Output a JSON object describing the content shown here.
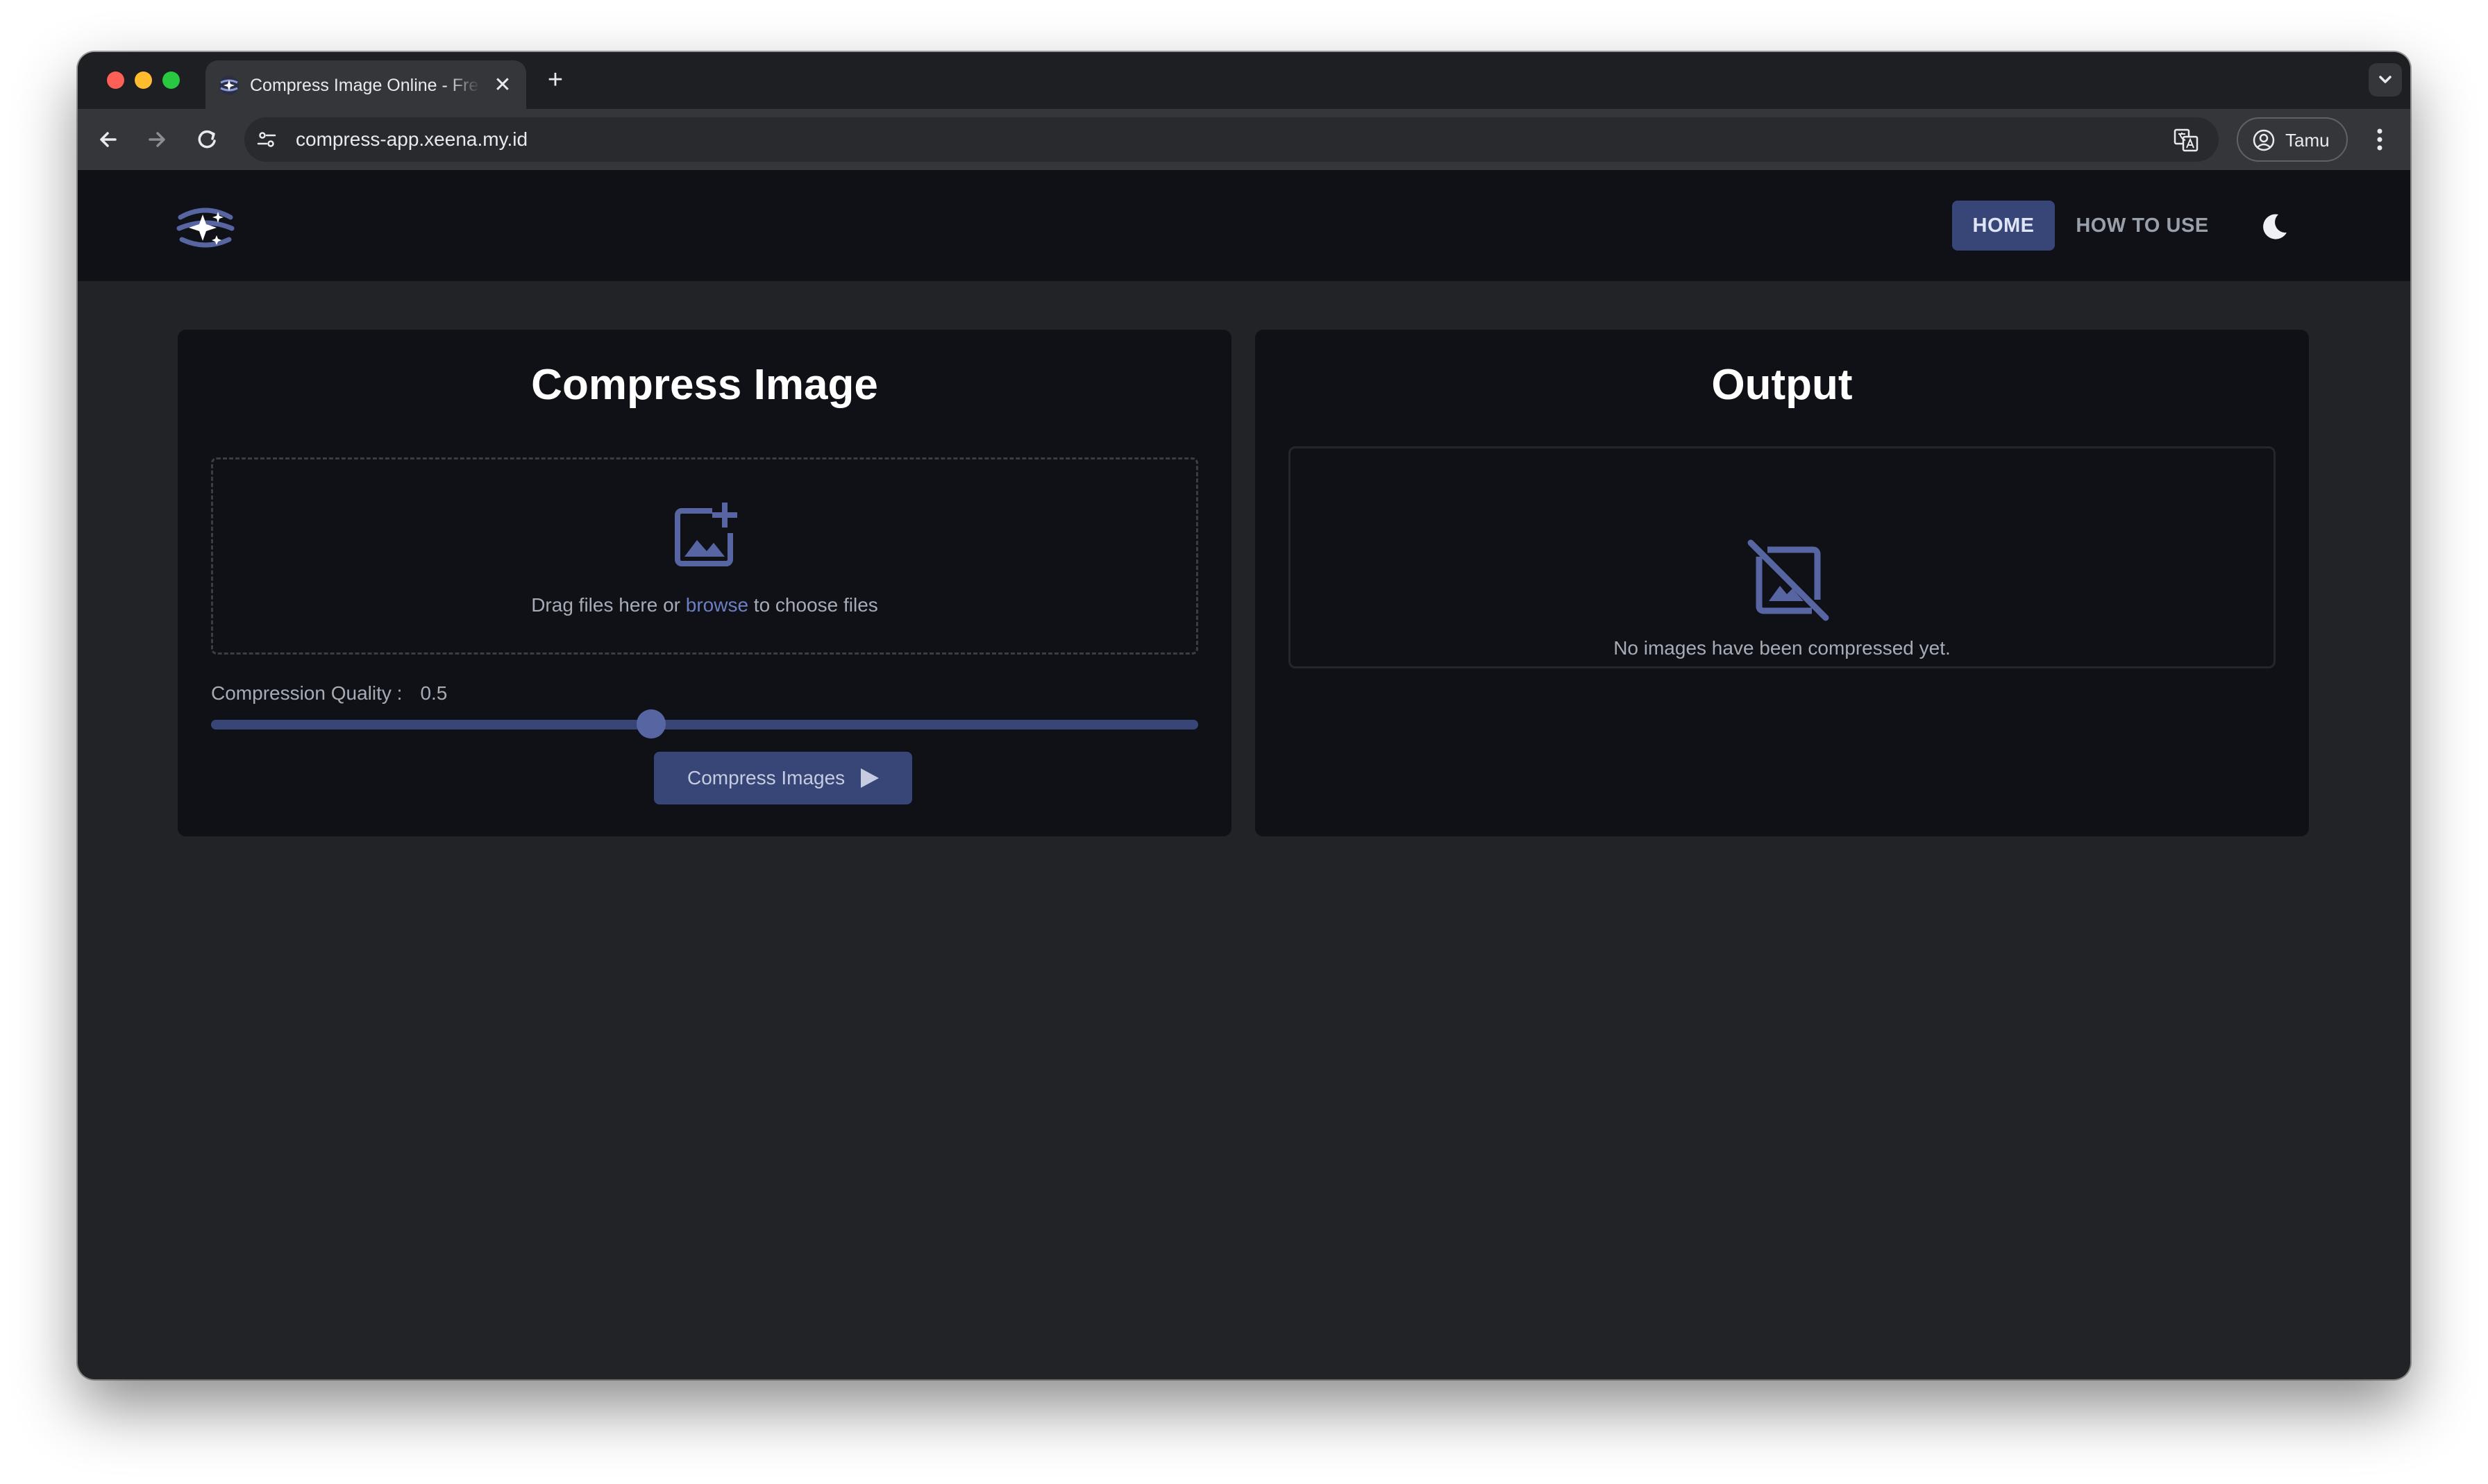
{
  "browser": {
    "tab_title": "Compress Image Online - Free",
    "tab_close_icon": "close-icon",
    "new_tab_icon": "plus-icon",
    "url": "compress-app.xeena.my.id",
    "profile_label": "Tamu"
  },
  "header": {
    "nav": {
      "home": "HOME",
      "how_to_use": "HOW TO USE"
    },
    "theme_icon": "moon-icon"
  },
  "compress_card": {
    "title": "Compress Image",
    "drop_text_before": "Drag files here or ",
    "browse_link": "browse",
    "drop_text_after": " to choose files",
    "quality_label": "Compression Quality :",
    "quality_value": "0.5",
    "quality_level": 0.5,
    "button_label": "Compress Images"
  },
  "output_card": {
    "title": "Output",
    "empty_message": "No images have been compressed yet."
  },
  "colors": {
    "page_bg": "#222326",
    "header_bg": "#0f1117",
    "card_bg": "#0f1117",
    "accent": "#384677",
    "icon_accent": "#5766a3",
    "link": "#6d7fc4"
  }
}
